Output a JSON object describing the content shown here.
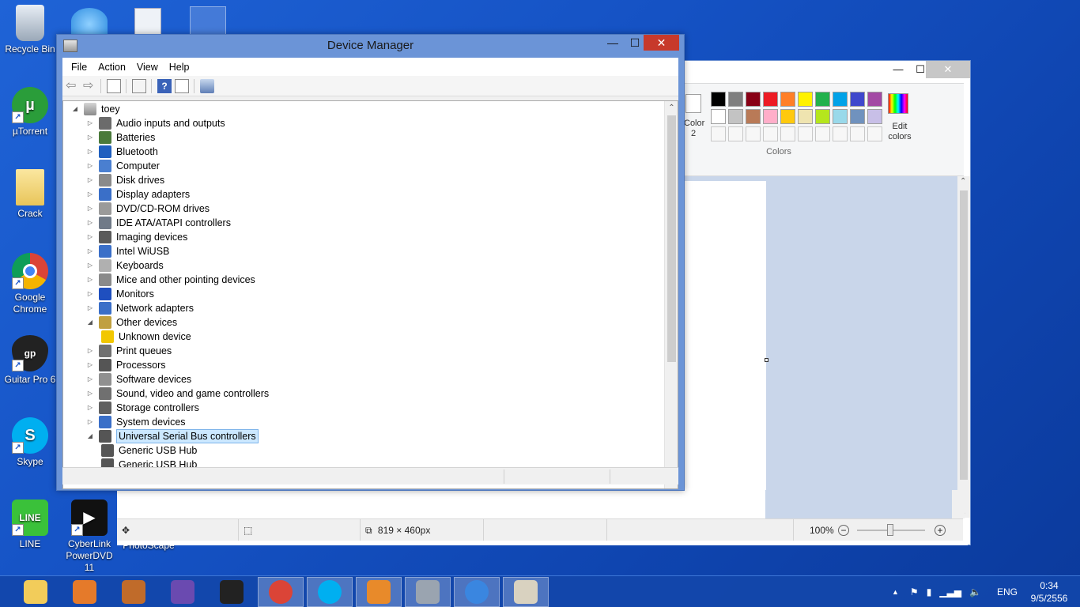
{
  "desktop_icons": [
    {
      "label": "Recycle Bin",
      "icon": "recycle-bin-icon"
    },
    {
      "label": "µTorrent",
      "icon": "utorrent-icon"
    },
    {
      "label": "Crack",
      "icon": "folder-icon"
    },
    {
      "label": "Google Chrome",
      "icon": "chrome-icon"
    },
    {
      "label": "Guitar Pro 6",
      "icon": "guitar-pro-icon"
    },
    {
      "label": "Skype",
      "icon": "skype-icon"
    },
    {
      "label": "LINE",
      "icon": "line-icon"
    },
    {
      "label": "CyberLink PowerDVD 11",
      "icon": "powerdvd-icon"
    },
    {
      "label": "PhotoScape",
      "icon": "photoscape-icon"
    }
  ],
  "device_manager": {
    "title": "Device Manager",
    "menu": [
      "File",
      "Action",
      "View",
      "Help"
    ],
    "root": "toey",
    "tree": [
      {
        "label": "Audio inputs and outputs",
        "expanded": false,
        "level": 1
      },
      {
        "label": "Batteries",
        "expanded": false,
        "level": 1
      },
      {
        "label": "Bluetooth",
        "expanded": false,
        "level": 1
      },
      {
        "label": "Computer",
        "expanded": false,
        "level": 1
      },
      {
        "label": "Disk drives",
        "expanded": false,
        "level": 1
      },
      {
        "label": "Display adapters",
        "expanded": false,
        "level": 1
      },
      {
        "label": "DVD/CD-ROM drives",
        "expanded": false,
        "level": 1
      },
      {
        "label": "IDE ATA/ATAPI controllers",
        "expanded": false,
        "level": 1
      },
      {
        "label": "Imaging devices",
        "expanded": false,
        "level": 1
      },
      {
        "label": "Intel WiUSB",
        "expanded": false,
        "level": 1
      },
      {
        "label": "Keyboards",
        "expanded": false,
        "level": 1
      },
      {
        "label": "Mice and other pointing devices",
        "expanded": false,
        "level": 1
      },
      {
        "label": "Monitors",
        "expanded": false,
        "level": 1
      },
      {
        "label": "Network adapters",
        "expanded": false,
        "level": 1
      },
      {
        "label": "Other devices",
        "expanded": true,
        "level": 1
      },
      {
        "label": "Unknown device",
        "expanded": null,
        "level": 2
      },
      {
        "label": "Print queues",
        "expanded": false,
        "level": 1
      },
      {
        "label": "Processors",
        "expanded": false,
        "level": 1
      },
      {
        "label": "Software devices",
        "expanded": false,
        "level": 1
      },
      {
        "label": "Sound, video and game controllers",
        "expanded": false,
        "level": 1
      },
      {
        "label": "Storage controllers",
        "expanded": false,
        "level": 1
      },
      {
        "label": "System devices",
        "expanded": false,
        "level": 1
      },
      {
        "label": "Universal Serial Bus controllers",
        "expanded": true,
        "level": 1,
        "selected": true
      },
      {
        "label": "Generic USB Hub",
        "expanded": null,
        "level": 2
      },
      {
        "label": "Generic USB Hub",
        "expanded": null,
        "level": 2
      }
    ]
  },
  "paint": {
    "color2_label": "Color\n2",
    "colors_group": "Colors",
    "edit_colors": "Edit colors",
    "palette_row1": [
      "#000000",
      "#7f7f7f",
      "#880015",
      "#ed1c24",
      "#ff7f27",
      "#fff200",
      "#22b14c",
      "#00a2e8",
      "#3f48cc",
      "#a349a4"
    ],
    "palette_row2": [
      "#ffffff",
      "#c3c3c3",
      "#b97a57",
      "#ffaec9",
      "#ffc90e",
      "#efe4b0",
      "#b5e61d",
      "#99d9ea",
      "#7092be",
      "#c8bfe7"
    ],
    "image_size": "819 × 460px",
    "zoom": "100%"
  },
  "taskbar": {
    "apps": [
      "file-explorer-icon",
      "control-panel-icon",
      "video-editor-icon",
      "visual-studio-icon",
      "guitar-pro-icon",
      "chrome-icon",
      "skype-icon",
      "media-player-icon",
      "device-manager-icon",
      "itunes-icon",
      "paint-icon"
    ],
    "language": "ENG",
    "time": "0:34",
    "date": "9/5/2556"
  }
}
